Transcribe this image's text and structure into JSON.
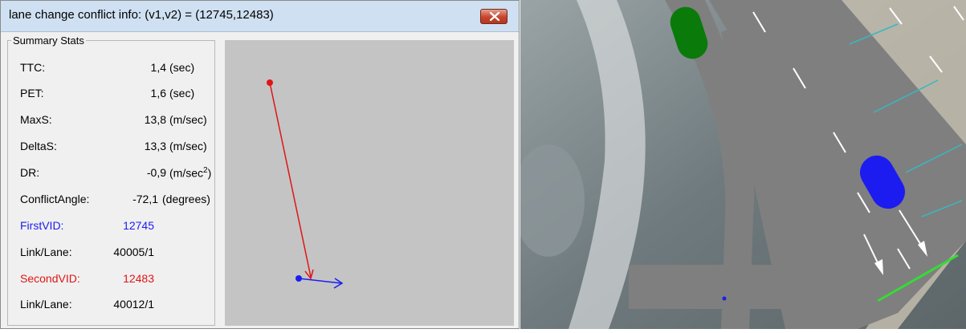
{
  "window": {
    "title": "lane change conflict info: (v1,v2) = (12745,12483)",
    "close_icon": "close-icon"
  },
  "summary": {
    "legend": "Summary Stats",
    "rows": [
      {
        "label": "TTC:",
        "value": "1,4",
        "unit": "(sec)"
      },
      {
        "label": "PET:",
        "value": "1,6",
        "unit": "(sec)"
      },
      {
        "label": "MaxS:",
        "value": "13,8",
        "unit": "(m/sec)"
      },
      {
        "label": "DeltaS:",
        "value": "13,3",
        "unit": "(m/sec)"
      },
      {
        "label": "DR:",
        "value": "-0,9",
        "unit": "(m/sec",
        "unit_sup": "2",
        "unit_end": ")"
      },
      {
        "label": "ConflictAngle:",
        "value": "-72,1",
        "unit": "(degrees)"
      }
    ],
    "first_vid": {
      "label": "FirstVID:",
      "value": "12745"
    },
    "first_link": {
      "label": "Link/Lane:",
      "value": "40005/1"
    },
    "second_vid": {
      "label": "SecondVID:",
      "value": "12483"
    },
    "second_link": {
      "label": "Link/Lane:",
      "value": "40012/1"
    }
  },
  "colors": {
    "first_vehicle": "#1c1cf0",
    "second_vehicle": "#e01515",
    "conflict_line": "#33dd33",
    "road": "#7f7f7f",
    "vehicle_top": "#0a7a0a"
  }
}
